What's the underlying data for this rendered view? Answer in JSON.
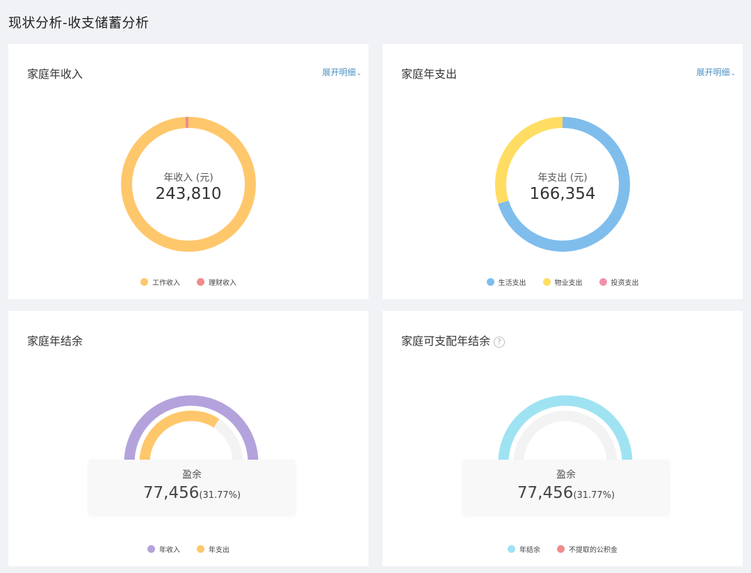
{
  "page_title": "现状分析-收支储蓄分析",
  "expand_label": "展开明细",
  "chart_data": [
    {
      "id": "income",
      "type": "pie",
      "title": "家庭年收入",
      "center_label": "年收入 (元)",
      "center_value": "243,810",
      "series": [
        {
          "name": "工作收入",
          "value": 242000,
          "color": "#ffc76b"
        },
        {
          "name": "理财收入",
          "value": 1810,
          "color": "#f08c8c"
        }
      ]
    },
    {
      "id": "expense",
      "type": "pie",
      "title": "家庭年支出",
      "center_label": "年支出 (元)",
      "center_value": "166,354",
      "series": [
        {
          "name": "生活支出",
          "value": 117000,
          "color": "#7fbdec"
        },
        {
          "name": "物业支出",
          "value": 49354,
          "color": "#ffdd63"
        },
        {
          "name": "投资支出",
          "value": 0,
          "color": "#f191ac"
        }
      ]
    },
    {
      "id": "balance",
      "type": "gauge",
      "title": "家庭年结余",
      "center_label": "盈余",
      "center_value": "77,456",
      "center_percent": "(31.77%)",
      "series": [
        {
          "name": "年收入",
          "value": 1.0,
          "color": "#b4a2dc"
        },
        {
          "name": "年支出",
          "value": 0.6823,
          "color": "#ffc76b"
        }
      ]
    },
    {
      "id": "disposable",
      "type": "gauge",
      "title": "家庭可支配年结余",
      "center_label": "盈余",
      "center_value": "77,456",
      "center_percent": "(31.77%)",
      "series": [
        {
          "name": "年结余",
          "value": 1.0,
          "color": "#9fe3f2"
        },
        {
          "name": "不提取的公积金",
          "value": 0,
          "color": "#f08c8c"
        }
      ]
    }
  ]
}
